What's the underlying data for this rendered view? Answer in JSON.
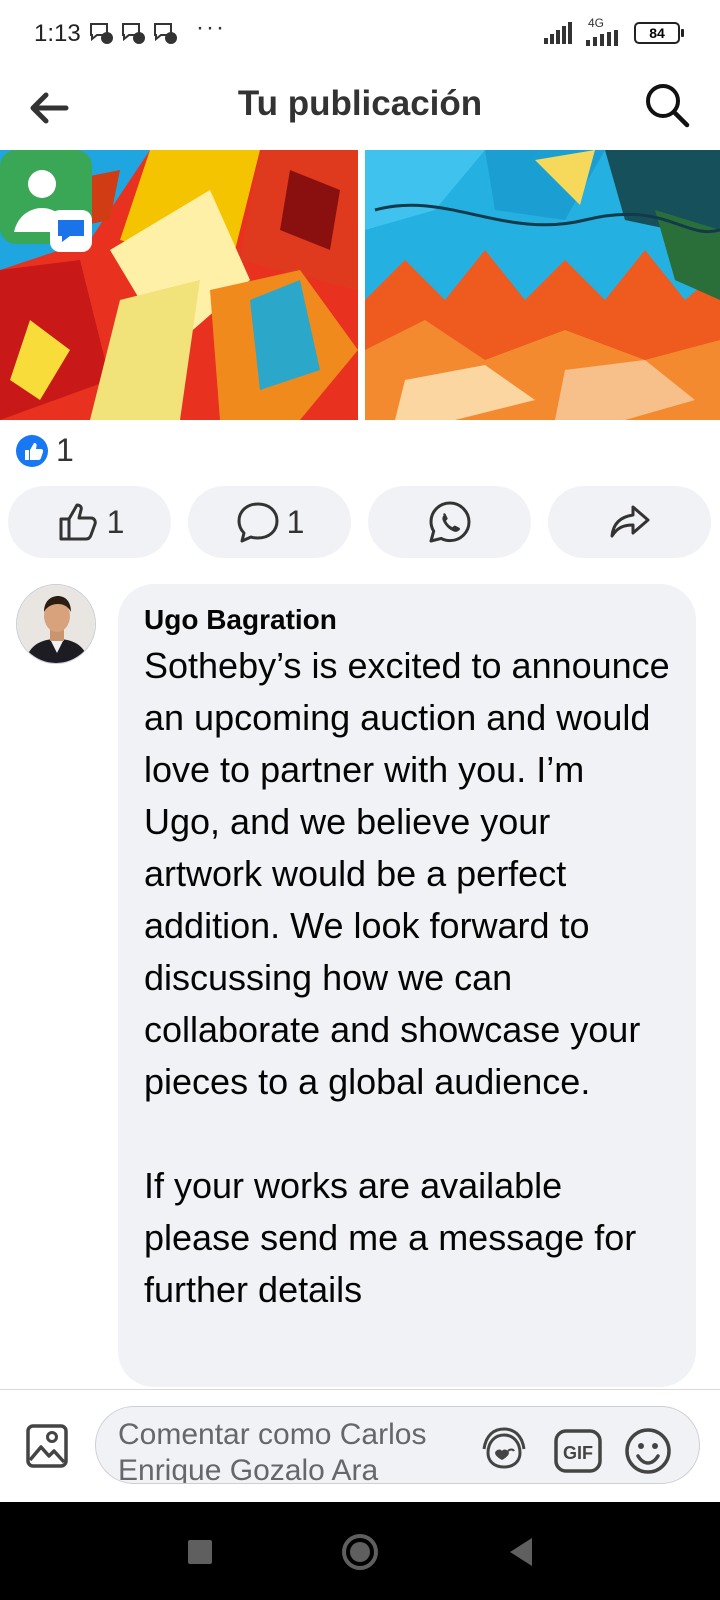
{
  "status_bar": {
    "time": "1:13",
    "more": "···",
    "network": "4G",
    "battery": "84"
  },
  "header": {
    "title": "Tu publicación"
  },
  "post": {
    "reaction_count": "1"
  },
  "actions": {
    "like_count": "1",
    "comment_count": "1"
  },
  "comment": {
    "author": "Ugo Bagration",
    "text": "Sotheby’s is excited to announce an upcoming auction and would love to partner with you. I’m Ugo, and we believe your artwork would be a perfect addition. We look forward to discussing how we can collaborate and showcase your pieces to a global audience.\n\nIf your works are available please send me a message for further details"
  },
  "composer": {
    "placeholder": "Comentar como Carlos Enrique Gozalo Ara"
  },
  "colors": {
    "accent": "#1877f2",
    "bubble": "#f0f2f5",
    "text": "#050505",
    "secondary": "#65676b"
  },
  "icons": [
    "back-arrow-icon",
    "search-icon",
    "like-icon",
    "comment-icon",
    "whatsapp-icon",
    "share-icon",
    "photo-icon",
    "avatar-sticker-icon",
    "gif-icon",
    "emoji-icon"
  ]
}
